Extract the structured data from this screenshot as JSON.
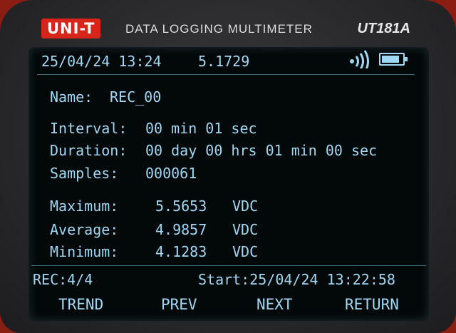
{
  "device": {
    "logo": "UNI-T",
    "title": "DATA LOGGING MULTIMETER",
    "model": "UT181A"
  },
  "status": {
    "datetime": "25/04/24 13:24",
    "reading": "5.1729",
    "signal_icon": "wireless-signal-icon",
    "battery_icon": "battery-icon",
    "battery_level": 0.85
  },
  "record": {
    "name_label": "Name:",
    "name": "REC_00",
    "interval_label": "Interval:",
    "interval": "00 min 01 sec",
    "duration_label": "Duration:",
    "duration": "00 day 00 hrs 01 min 00 sec",
    "samples_label": "Samples:",
    "samples": "000061"
  },
  "stats": [
    {
      "label": "Maximum:",
      "value": "5.5653",
      "unit": "VDC"
    },
    {
      "label": "Average:",
      "value": "4.9857",
      "unit": "VDC"
    },
    {
      "label": "Minimum:",
      "value": "4.1283",
      "unit": "VDC"
    }
  ],
  "footer": {
    "rec": "REC:4/4",
    "start": "Start:25/04/24 13:22:58"
  },
  "softkeys": [
    "TREND",
    "PREV",
    "NEXT",
    "RETURN"
  ]
}
